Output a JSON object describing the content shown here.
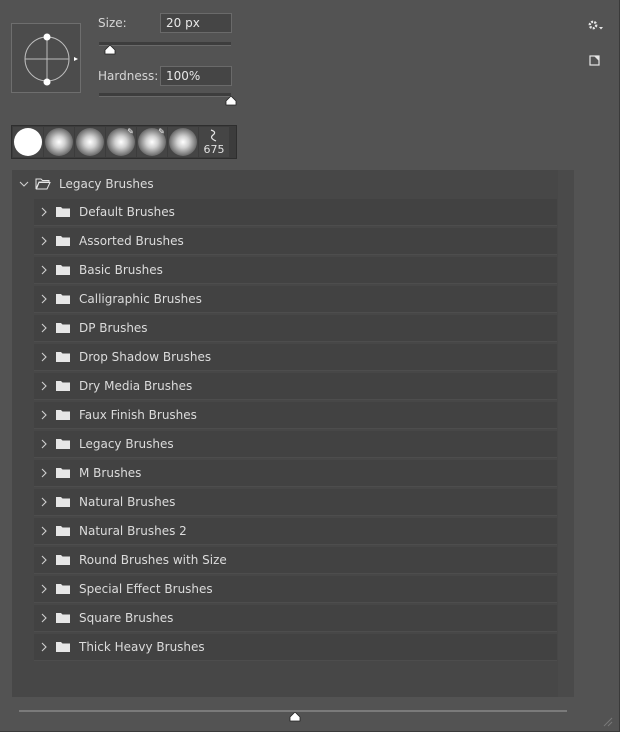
{
  "brush_options": {
    "size_label": "Size:",
    "size_value": "20 px",
    "size_slider_fraction": 0.09,
    "hardness_label": "Hardness:",
    "hardness_value": "100%",
    "hardness_slider_fraction": 1.0
  },
  "recent_presets": [
    {
      "kind": "hard"
    },
    {
      "kind": "soft"
    },
    {
      "kind": "soft"
    },
    {
      "kind": "soft-pressure"
    },
    {
      "kind": "soft-pressure"
    },
    {
      "kind": "soft"
    },
    {
      "kind": "special",
      "number": "675"
    }
  ],
  "tree": {
    "group_label": "Legacy Brushes",
    "items": [
      "Default Brushes",
      "Assorted Brushes",
      "Basic Brushes",
      "Calligraphic Brushes",
      "DP Brushes",
      "Drop Shadow Brushes",
      "Dry Media Brushes",
      "Faux Finish Brushes",
      "Legacy Brushes",
      "M Brushes",
      "Natural Brushes",
      "Natural Brushes 2",
      "Round Brushes with Size",
      "Special Effect Brushes",
      "Square Brushes",
      "Thick Heavy Brushes"
    ]
  },
  "preview_size_slider_fraction": 0.5
}
